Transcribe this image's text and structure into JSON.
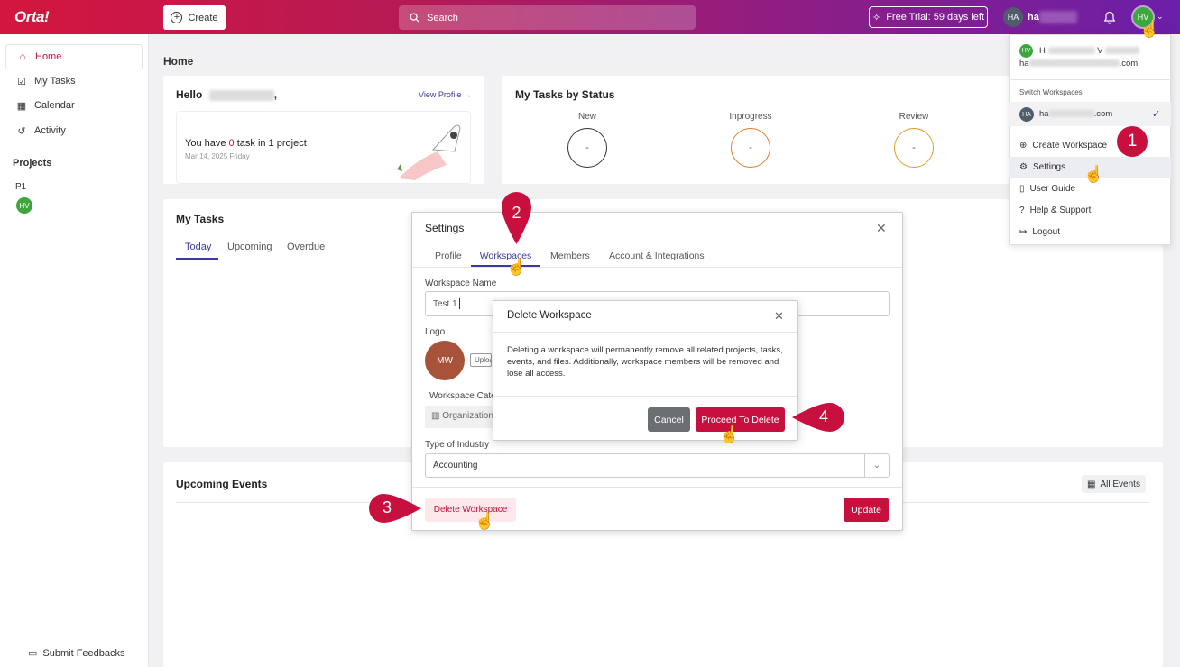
{
  "topbar": {
    "logo": "Orta!",
    "create_label": "Create",
    "search_placeholder": "Search",
    "trial_label": "Free Trial: 59 days left",
    "user_initials": "HA",
    "user_name": "ha",
    "avatar_initials": "HV"
  },
  "sidebar": {
    "items": [
      {
        "label": "Home",
        "icon": "home-icon"
      },
      {
        "label": "My Tasks",
        "icon": "checkbox-icon"
      },
      {
        "label": "Calendar",
        "icon": "calendar-icon"
      },
      {
        "label": "Activity",
        "icon": "history-icon"
      }
    ],
    "projects_heading": "Projects",
    "project_name": "P1",
    "project_avatar": "HV",
    "feedback_label": "Submit Feedbacks"
  },
  "main": {
    "title": "Home",
    "hello": "Hello",
    "hello_suffix": ",",
    "view_profile": "View Profile →",
    "task_text_pre": "You have ",
    "task_count": "0",
    "task_text_post": " task in 1 project",
    "task_date": "Mar 14, 2025 Friday",
    "status_title": "My Tasks by Status",
    "statuses": [
      {
        "label": "New",
        "value": "-",
        "color": "#333333"
      },
      {
        "label": "Inprogress",
        "value": "-",
        "color": "#e07b2a"
      },
      {
        "label": "Review",
        "value": "-",
        "color": "#e0a02a"
      }
    ],
    "mytasks_title": "My Tasks",
    "task_tabs": [
      "Today",
      "Upcoming",
      "Overdue"
    ],
    "upcoming_title": "Upcoming Events",
    "all_events": "All Events"
  },
  "settings": {
    "title": "Settings",
    "tabs": [
      "Profile",
      "Workspaces",
      "Members",
      "Account & Integrations"
    ],
    "ws_name_label": "Workspace Name",
    "ws_name_value": "Test 1",
    "logo_label": "Logo",
    "logo_initials": "MW",
    "upload_label": "Upload",
    "category_label": "Workspace Category",
    "category_value": "Organization",
    "industry_label": "Type of Industry",
    "industry_value": "Accounting",
    "delete_label": "Delete Workspace",
    "update_label": "Update"
  },
  "delete_dialog": {
    "title": "Delete Workspace",
    "body": "Deleting a workspace will permanently remove all related projects, tasks, events, and files. Additionally, workspace members will be removed and lose all access.",
    "cancel_label": "Cancel",
    "proceed_label": "Proceed To Delete"
  },
  "user_menu": {
    "avatar": "HV",
    "name": "H",
    "name_mid": "V",
    "email_start": "ha",
    "email_end": ".com",
    "switch_label": "Switch Workspaces",
    "workspace_initials": "HA",
    "workspace_start": "ha",
    "workspace_end": ".com",
    "items": [
      {
        "label": "Create Workspace",
        "icon": "plus-circle-icon"
      },
      {
        "label": "Settings",
        "icon": "gear-icon"
      },
      {
        "label": "User Guide",
        "icon": "book-icon"
      },
      {
        "label": "Help & Support",
        "icon": "help-icon"
      },
      {
        "label": "Logout",
        "icon": "logout-icon"
      }
    ]
  },
  "step_badges": [
    "1",
    "2",
    "3",
    "4"
  ],
  "colors": {
    "brand": "#c8103f",
    "accent": "#3a3aa0"
  }
}
